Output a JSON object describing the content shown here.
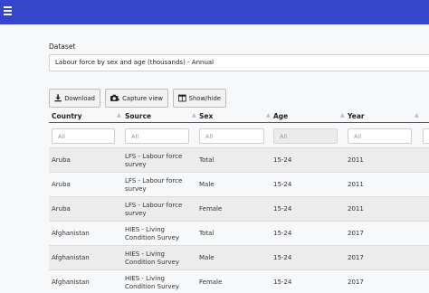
{
  "header": {
    "menu_icon": "hamburger-menu-icon"
  },
  "dataset": {
    "label": "Dataset",
    "selected": "Labour force by sex and age (thousands) - Annual"
  },
  "toolbar": {
    "download_label": "Download",
    "capture_label": "Capture view",
    "showhide_label": "Show/hide"
  },
  "table": {
    "columns": [
      "Country",
      "Source",
      "Sex",
      "Age",
      "Year"
    ],
    "filters": [
      {
        "placeholder": "All"
      },
      {
        "placeholder": "All"
      },
      {
        "placeholder": "All"
      },
      {
        "placeholder": "All"
      },
      {
        "placeholder": "All"
      }
    ],
    "rows": [
      {
        "country": "Aruba",
        "source": "LFS - Labour force survey",
        "sex": "Total",
        "age": "15-24",
        "year": "2011"
      },
      {
        "country": "Aruba",
        "source": "LFS - Labour force survey",
        "sex": "Male",
        "age": "15-24",
        "year": "2011"
      },
      {
        "country": "Aruba",
        "source": "LFS - Labour force survey",
        "sex": "Female",
        "age": "15-24",
        "year": "2011"
      },
      {
        "country": "Afghanistan",
        "source": "HIES - Living Condition Survey",
        "sex": "Total",
        "age": "15-24",
        "year": "2017"
      },
      {
        "country": "Afghanistan",
        "source": "HIES - Living Condition Survey",
        "sex": "Male",
        "age": "15-24",
        "year": "2017"
      },
      {
        "country": "Afghanistan",
        "source": "HIES - Living Condition Survey",
        "sex": "Female",
        "age": "15-24",
        "year": "2017"
      }
    ]
  },
  "colors": {
    "topbar": "#3545cc",
    "row_alt": "#ececec"
  }
}
